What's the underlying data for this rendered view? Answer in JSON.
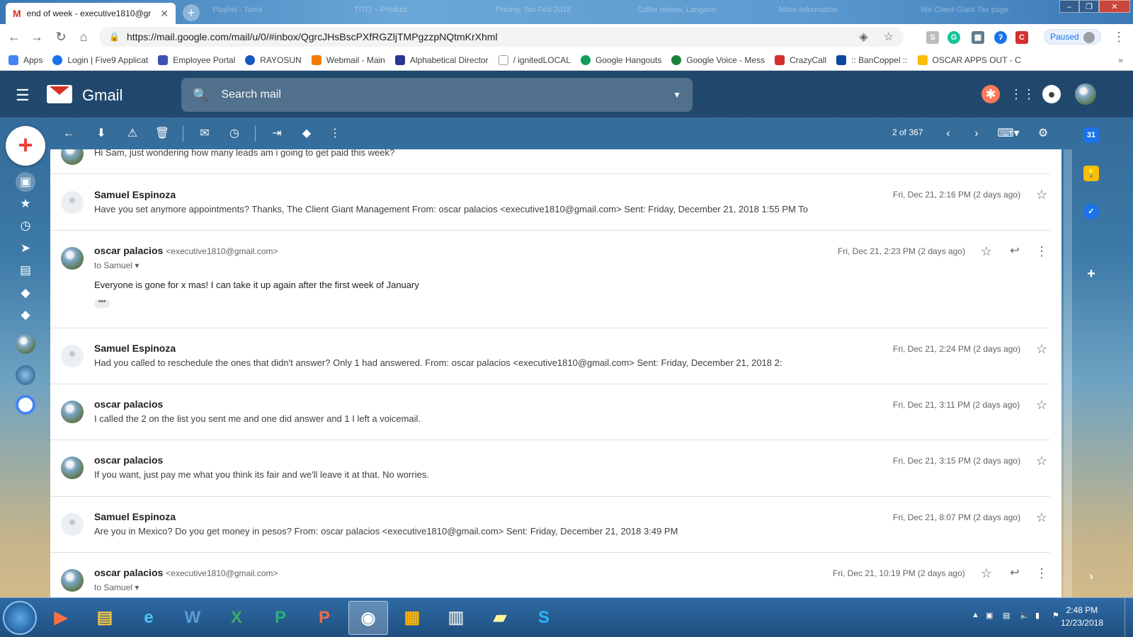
{
  "browser": {
    "tab_title": "end of week - executive1810@gr",
    "background_tabs": [
      "Playlist - Tania",
      "TITO ~ Product",
      "Pricing, Tax Fed 2018",
      "Caller review, Langson",
      "More Information",
      "We Client Giant Tax page"
    ],
    "url": "https://mail.google.com/mail/u/0/#inbox/QgrcJHsBscPXfRGZljTMPgzzpNQtmKrXhml",
    "paused_label": "Paused",
    "bookmarks": [
      {
        "label": "Apps",
        "color": "#4285f4"
      },
      {
        "label": "Login | Five9 Applicat",
        "color": "#1a73e8"
      },
      {
        "label": "Employee Portal",
        "color": "#3f51b5"
      },
      {
        "label": "RAYOSUN",
        "color": "#1a57c6"
      },
      {
        "label": "Webmail - Main",
        "color": "#f57c00"
      },
      {
        "label": "Alphabetical Director",
        "color": "#283593"
      },
      {
        "label": "/ ignitedLOCAL",
        "color": "#9e9e9e"
      },
      {
        "label": "Google Hangouts",
        "color": "#0f9d58"
      },
      {
        "label": "Google Voice - Mess",
        "color": "#188038"
      },
      {
        "label": "CrazyCall",
        "color": "#d32f2f"
      },
      {
        "label": ":: BanCoppel ::",
        "color": "#0d47a1"
      },
      {
        "label": "OSCAR APPS OUT - C",
        "color": "#fbbc04"
      }
    ],
    "bookmarks_more": "»"
  },
  "gmail": {
    "brand": "Gmail",
    "search_placeholder": "Search mail",
    "pager": "2 of 367"
  },
  "messages": [
    {
      "sender": "",
      "email": "",
      "snippet": "Hi Sam, just wondering how many leads am i going to get paid this week?",
      "date": ""
    },
    {
      "sender": "Samuel Espinoza",
      "email": "",
      "snippet": "Have you set anymore appointments? Thanks, The Client Giant Management From: oscar palacios <executive1810@gmail.com> Sent: Friday, December 21, 2018 1:55 PM To",
      "date": "Fri, Dec 21, 2:16 PM (2 days ago)"
    },
    {
      "sender": "oscar palacios",
      "email": "<executive1810@gmail.com>",
      "to": "to Samuel",
      "body": "Everyone is gone for x mas!  I can take it up again after the first week of January",
      "date": "Fri, Dec 21, 2:23 PM (2 days ago)"
    },
    {
      "sender": "Samuel Espinoza",
      "email": "",
      "snippet": "Had you called to reschedule the ones that didn't answer? Only 1 had answered. From: oscar palacios <executive1810@gmail.com> Sent: Friday, December 21, 2018 2:",
      "date": "Fri, Dec 21, 2:24 PM (2 days ago)"
    },
    {
      "sender": "oscar palacios",
      "email": "",
      "snippet": "I called the 2 on the list you sent me and one did answer and 1 I left a voicemail.",
      "date": "Fri, Dec 21, 3:11 PM (2 days ago)"
    },
    {
      "sender": "oscar palacios",
      "email": "",
      "snippet": "If you want, just pay me what you think its fair and we'll leave it at that. No worries.",
      "date": "Fri, Dec 21, 3:15 PM (2 days ago)"
    },
    {
      "sender": "Samuel Espinoza",
      "email": "",
      "snippet": "Are you in Mexico? Do you get money in pesos? From: oscar palacios <executive1810@gmail.com> Sent: Friday, December 21, 2018 3:49 PM",
      "date": "Fri, Dec 21, 8:07 PM (2 days ago)"
    },
    {
      "sender": "oscar palacios",
      "email": "<executive1810@gmail.com>",
      "to": "to Samuel",
      "date": "Fri, Dec 21, 10:19 PM (2 days ago)"
    }
  ],
  "side_panel": {
    "calendar_day": "31"
  },
  "taskbar": {
    "time": "2:48 PM",
    "date": "12/23/2018",
    "apps": [
      "media-player",
      "file-explorer",
      "internet-explorer",
      "word",
      "excel",
      "publisher",
      "powerpoint",
      "chrome",
      "puzzle-cube",
      "calculator",
      "sticky-notes",
      "skype"
    ]
  }
}
